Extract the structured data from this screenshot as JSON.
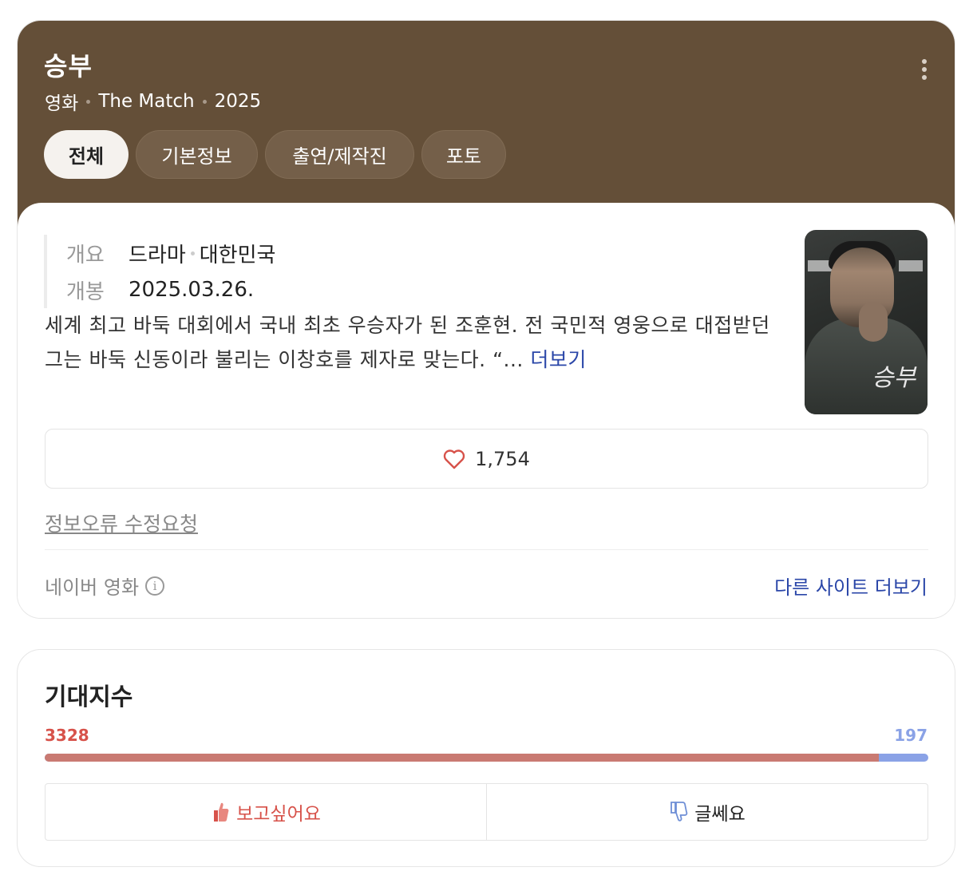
{
  "movie": {
    "title": "승부",
    "meta": [
      "영화",
      "The Match",
      "2025"
    ],
    "tabs": [
      {
        "label": "전체",
        "active": true
      },
      {
        "label": "기본정보",
        "active": false
      },
      {
        "label": "출연/제작진",
        "active": false
      },
      {
        "label": "포토",
        "active": false
      }
    ]
  },
  "info": {
    "overview_label": "개요",
    "genre": "드라마",
    "country": "대한민국",
    "release_label": "개봉",
    "release_date": "2025.03.26."
  },
  "synopsis": {
    "text": "세계 최고 바둑 대회에서 국내 최초 우승자가 된 조훈현. 전 국민적 영웅으로 대접받던 그는 바둑 신동이라 불리는 이창호를 제자로 맞는다. “...",
    "more_label": "더보기"
  },
  "poster": {
    "title_text": "승부"
  },
  "likes": {
    "count": "1,754",
    "icon": "heart-icon"
  },
  "footer": {
    "report_label": "정보오류 수정요청",
    "source_label": "네이버 영화",
    "other_sites_label": "다른 사이트 더보기"
  },
  "expectation": {
    "title": "기대지수",
    "positive_count": "3328",
    "negative_count": "197",
    "positive_ratio": 0.9441,
    "want_label": "보고싶어요",
    "meh_label": "글쎄요"
  },
  "colors": {
    "header_bg": "#644f38",
    "link": "#2a46a8",
    "positive": "#d7524a",
    "negative": "#8aa2e6"
  }
}
